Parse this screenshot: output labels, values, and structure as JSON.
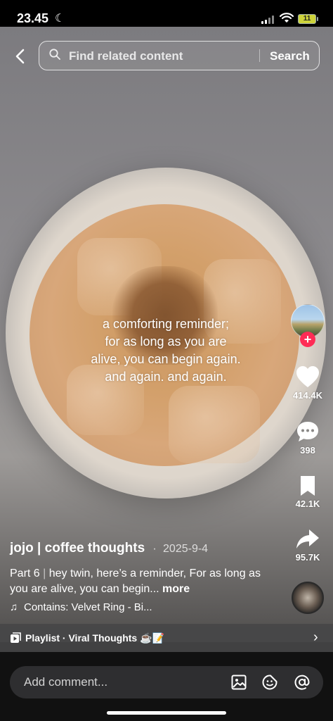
{
  "status_bar": {
    "time": "23.45",
    "battery": "11",
    "icons": [
      "moon-icon",
      "signal-icon",
      "wifi-icon",
      "battery-icon"
    ]
  },
  "search": {
    "back_icon": "chevron-left-icon",
    "placeholder": "Find related content",
    "button": "Search"
  },
  "video": {
    "overlay_text": [
      "a comforting reminder;",
      "for as long as you are",
      "alive, you can begin again.",
      "and again. and again."
    ]
  },
  "actions": {
    "like_count": "414.4K",
    "comment_count": "398",
    "save_count": "42.1K",
    "share_count": "95.7K",
    "follow_symbol": "+"
  },
  "post": {
    "author": "jojo | coffee thoughts",
    "separator": "·",
    "date": "2025-9-4",
    "caption_part": "Part 6",
    "caption_divider": "|",
    "caption_text": "hey twin, here’s a reminder,  For as long as you are alive, you can begin...",
    "more": "more",
    "music_prefix": "Contains:",
    "music_title": "Velvet Ring - Bi..."
  },
  "playlist": {
    "label": "Playlist · Viral Thoughts ☕📝",
    "chevron": "›"
  },
  "comment": {
    "placeholder": "Add comment..."
  },
  "colors": {
    "accent": "#fe2c55",
    "battery": "#cdd33a"
  }
}
